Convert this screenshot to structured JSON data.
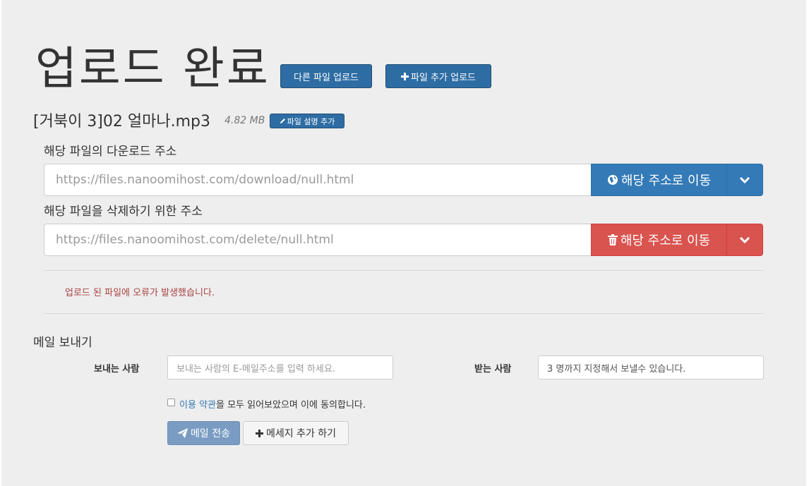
{
  "header": {
    "title": "업로드 완료",
    "other_upload_label": "다른 파일 업로드",
    "add_upload_label": "파일 추가 업로드"
  },
  "file": {
    "name": "[거북이 3]02 얼마나.mp3",
    "size": "4.82 MB",
    "add_desc_label": "파일 설명 추가"
  },
  "download": {
    "label": "해당 파일의 다운로드 주소",
    "url": "https://files.nanoomihost.com/download/null.html",
    "go_label": "해당 주소로 이동",
    "icon": "globe-icon",
    "color": "#337ab7"
  },
  "delete": {
    "label": "해당 파일을 삭제하기 위한 주소",
    "url": "https://files.nanoomihost.com/delete/null.html",
    "go_label": "해당 주소로 이동",
    "icon": "trash-icon",
    "color": "#d9534f"
  },
  "error_message": "업로드 된 파일에 오류가 발생했습니다.",
  "mail": {
    "section_title": "메일 보내기",
    "sender_label": "보내는 사람",
    "sender_placeholder": "보내는 사람의 E-메일주소를 입력 하세요.",
    "receiver_label": "받는 사람",
    "receiver_value": "3 명까지 지정해서 보낼수 있습니다.",
    "terms_link": "이용 약관",
    "terms_text": "을 모두 읽어보았으며 이에 동의합니다.",
    "send_label": "메일 전송",
    "add_message_label": "메세지 추가 하기"
  }
}
